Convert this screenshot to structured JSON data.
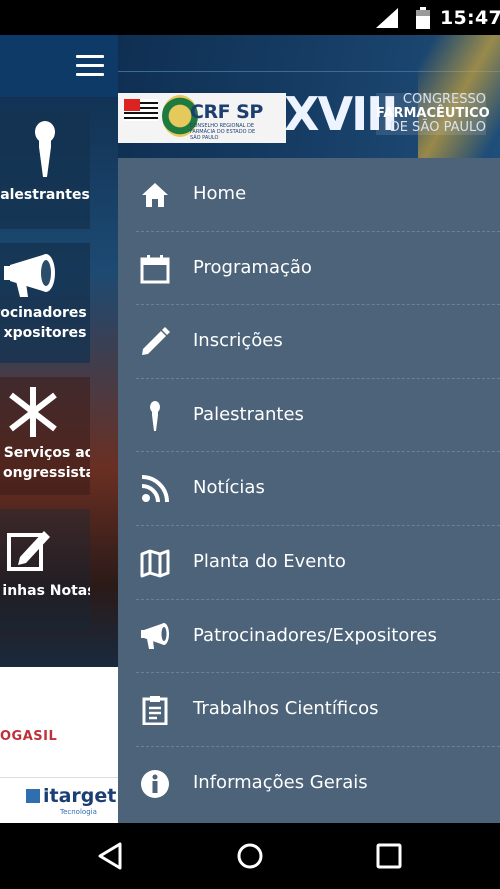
{
  "status_bar": {
    "time": "15:47",
    "icons": [
      "signal-icon",
      "battery-icon"
    ]
  },
  "background_app": {
    "tiles": [
      {
        "icon": "microphone-icon",
        "label": "alestrantes"
      },
      {
        "icon": "megaphone-icon",
        "label": "rocinadores /",
        "label2": "xpositores"
      },
      {
        "icon": "asterisk-icon",
        "label": "Serviços ao",
        "label2": "ongressista"
      },
      {
        "icon": "edit-note-icon",
        "label": "inhas Notas"
      }
    ],
    "sponsor1": "OGASIL",
    "sponsor2": "itarget",
    "sponsor2_sub": "Tecnologia"
  },
  "banner": {
    "crf": "CRF SP",
    "crf_sub": "CONSELHO REGIONAL DE FARMÁCIA DO ESTADO DE SÃO PAULO",
    "edition": "XVIII",
    "congress_line1": "CONGRESSO",
    "congress_line2": "FARMACÊUTICO",
    "congress_line3": "DE SÃO PAULO"
  },
  "menu": [
    {
      "label": "Home",
      "icon": "home-icon"
    },
    {
      "label": "Programação",
      "icon": "calendar-icon"
    },
    {
      "label": "Inscrições",
      "icon": "pencil-icon"
    },
    {
      "label": "Palestrantes",
      "icon": "microphone-icon"
    },
    {
      "label": "Notícias",
      "icon": "rss-icon"
    },
    {
      "label": "Planta do Evento",
      "icon": "map-icon"
    },
    {
      "label": "Patrocinadores/Expositores",
      "icon": "megaphone-icon"
    },
    {
      "label": "Trabalhos Científicos",
      "icon": "clipboard-icon"
    },
    {
      "label": "Informações Gerais",
      "icon": "info-icon"
    }
  ],
  "nav_bar": {
    "buttons": [
      "back-icon",
      "home-circle-icon",
      "recents-icon"
    ]
  },
  "colors": {
    "drawer_bg": "#4c6379",
    "banner_bg": "#173e66",
    "text": "#ffffff"
  }
}
